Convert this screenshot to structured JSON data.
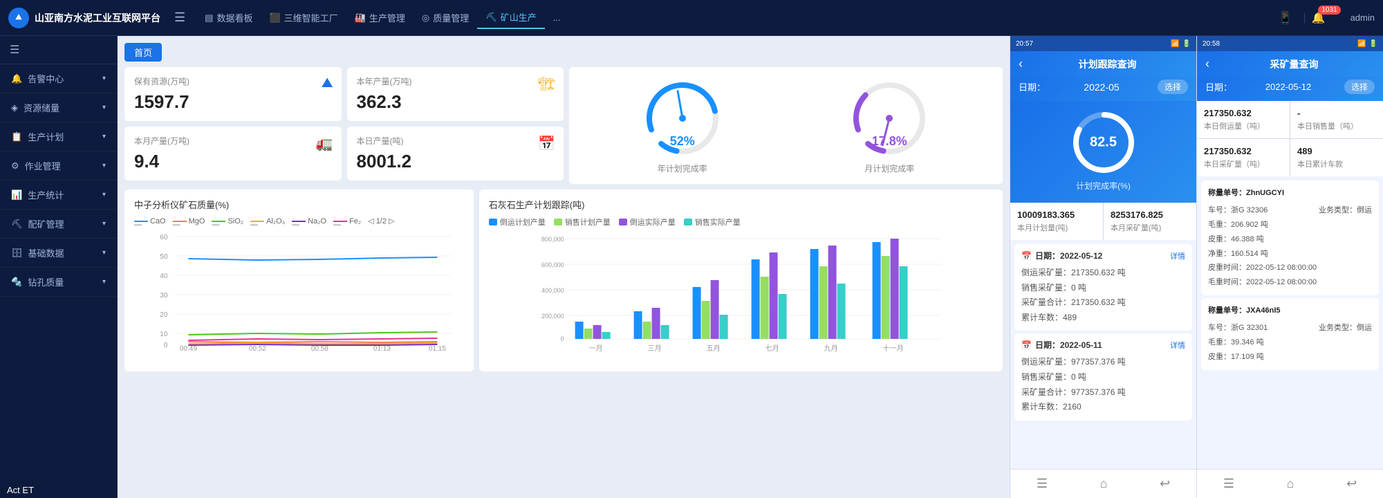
{
  "app": {
    "title": "山亚南方水泥工业互联网平台"
  },
  "topNav": {
    "logo_text": "山亚南方水泥工业互联网平台",
    "items": [
      {
        "label": "数据看板",
        "icon": "chart",
        "active": false
      },
      {
        "label": "三维智能工厂",
        "icon": "cube",
        "active": false
      },
      {
        "label": "生产管理",
        "icon": "factory",
        "active": false
      },
      {
        "label": "质量管理",
        "icon": "quality",
        "active": false
      },
      {
        "label": "矿山生产",
        "icon": "mine",
        "active": true
      },
      {
        "label": "...",
        "icon": "",
        "active": false
      }
    ],
    "notification_count": "1031",
    "admin_label": "admin"
  },
  "sidebar": {
    "items": [
      {
        "label": "告警中心",
        "icon": "bell"
      },
      {
        "label": "资源储量",
        "icon": "resource"
      },
      {
        "label": "生产计划",
        "icon": "plan"
      },
      {
        "label": "作业管理",
        "icon": "work"
      },
      {
        "label": "生产统计",
        "icon": "stats"
      },
      {
        "label": "配矿管理",
        "icon": "ore"
      },
      {
        "label": "基础数据",
        "icon": "data"
      },
      {
        "label": "钻孔质量",
        "icon": "drill"
      }
    ]
  },
  "breadcrumb": "首页",
  "stats": {
    "reserve": {
      "title": "保有资源(万吨)",
      "value": "1597.7"
    },
    "annual": {
      "title": "本年产量(万吨)",
      "value": "362.3"
    },
    "monthly": {
      "title": "本月产量(万吨)",
      "value": "9.4"
    },
    "daily": {
      "title": "本日产量(吨)",
      "value": "8001.2"
    }
  },
  "gauges": {
    "annual_pct": "52%",
    "annual_label": "年计划完成率",
    "monthly_pct": "17.8%",
    "monthly_label": "月计划完成率"
  },
  "lineChart": {
    "title": "中子分析仪矿石质量(%)",
    "legend": [
      {
        "label": "CaO",
        "color": "#1890ff"
      },
      {
        "label": "MgO",
        "color": "#ff7a45"
      },
      {
        "label": "SiO₂",
        "color": "#52c41a"
      },
      {
        "label": "Al₂O₃",
        "color": "#faad14"
      },
      {
        "label": "Na₂O",
        "color": "#722ed1"
      },
      {
        "label": "Fe₂",
        "color": "#eb2f96"
      },
      {
        "label": "1/2",
        "color": "#888"
      }
    ],
    "xLabels": [
      "00:49",
      "00:52",
      "00:58",
      "01:13",
      "01:15"
    ],
    "yLabels": [
      "0",
      "10",
      "20",
      "30",
      "40",
      "50",
      "60"
    ]
  },
  "barChart": {
    "title": "石灰石生产计划跟踪(吨)",
    "legend": [
      {
        "label": "倒运计划产量",
        "color": "#1890ff"
      },
      {
        "label": "销售计划产量",
        "color": "#95de64"
      },
      {
        "label": "倒运实际产量",
        "color": "#9254de"
      },
      {
        "label": "销售实际产量",
        "color": "#36cfc9"
      }
    ],
    "xLabels": [
      "一月",
      "三月",
      "五月",
      "七月",
      "九月",
      "十一月"
    ],
    "yLabels": [
      "0",
      "200,000",
      "400,000",
      "600,000",
      "800,000"
    ]
  },
  "mobile1": {
    "status_time": "20:57",
    "title": "计划跟踪查询",
    "date_label": "日期：",
    "date_value": "2022-05",
    "select_btn": "选择",
    "gauge_value": "82.5",
    "gauge_label": "计划完成率(%)",
    "stat1_value": "10009183.365",
    "stat1_label": "本月计划量(吨)",
    "stat2_value": "8253176.825",
    "stat2_label": "本月采矿量(吨)",
    "records": [
      {
        "date": "日期：2022-05-12",
        "detail": "详情",
        "rows": [
          "倒运采矿量：217350.632 吨",
          "销售采矿量：0 吨",
          "采矿量合计：217350.632 吨",
          "累计车数：489"
        ]
      },
      {
        "date": "日期：2022-05-11",
        "detail": "详情",
        "rows": [
          "倒运采矿量：977357.376 吨",
          "销售采矿量：0 吨",
          "采矿量合计：977357.376 吨",
          "累计车数：2160"
        ]
      }
    ]
  },
  "mobile2": {
    "status_time": "20:58",
    "title": "采矿量查询",
    "date_label": "日期：",
    "date_value": "2022-05-12",
    "select_btn": "选择",
    "stat1_value": "217350.632",
    "stat1_label": "本日倒运量（吨）",
    "stat2_value": "-",
    "stat2_label": "本日销售量（吨）",
    "stat3_value": "217350.632",
    "stat3_label": "本日采矿量（吨）",
    "stat4_value": "489",
    "stat4_label": "本日累计车款",
    "records": [
      {
        "title": "称量单号：ZhnUGCYI",
        "rows": [
          [
            "车号：浙G 32306",
            "业务类型：倒运"
          ],
          [
            "毛重：206.902 吨",
            ""
          ],
          [
            "皮重：46.388 吨",
            ""
          ],
          [
            "净重：160.514 吨",
            ""
          ],
          [
            "皮重时间：2022-05-12 08:00:00",
            ""
          ],
          [
            "毛重时间：2022-05-12 08:00:00",
            ""
          ]
        ]
      },
      {
        "title": "称量单号：JXA46nI5",
        "rows": [
          [
            "车号：浙G 32301",
            "业务类型：倒运"
          ],
          [
            "毛重：39.346 吨",
            ""
          ],
          [
            "皮重：17.109 吨",
            ""
          ]
        ]
      }
    ]
  },
  "actEt": "Act ET"
}
